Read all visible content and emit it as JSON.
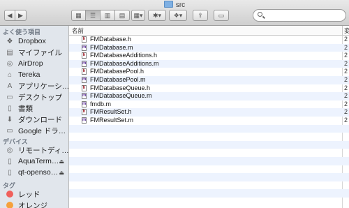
{
  "window": {
    "title": "src"
  },
  "toolbar": {
    "back_icon": "chevron-left-icon",
    "forward_icon": "chevron-right-icon",
    "view_buttons": [
      "icon-view-icon",
      "list-view-icon",
      "column-view-icon",
      "coverflow-view-icon",
      "arrange-icon"
    ],
    "action_icon": "gear-icon",
    "dropbox_icon": "dropbox-icon",
    "share_icon": "share-icon",
    "tag_icon": "tag-icon",
    "search_placeholder": ""
  },
  "sidebar": {
    "favorites_header": "よく使う項目",
    "favorites": [
      {
        "label": "Dropbox",
        "icon": "dropbox-icon"
      },
      {
        "label": "マイファイル",
        "icon": "all-files-icon"
      },
      {
        "label": "AirDrop",
        "icon": "airdrop-icon"
      },
      {
        "label": "Tereka",
        "icon": "home-icon"
      },
      {
        "label": "アプリケーシ…",
        "icon": "applications-icon"
      },
      {
        "label": "デスクトップ",
        "icon": "desktop-icon"
      },
      {
        "label": "書類",
        "icon": "documents-icon"
      },
      {
        "label": "ダウンロード",
        "icon": "downloads-icon"
      },
      {
        "label": "Google ドラ…",
        "icon": "folder-icon"
      }
    ],
    "devices_header": "デバイス",
    "devices": [
      {
        "label": "リモートディ…",
        "icon": "remote-disc-icon"
      },
      {
        "label": "AquaTerm…",
        "icon": "disk-icon",
        "eject": "⏏"
      },
      {
        "label": "qt-openso…",
        "icon": "disk-icon",
        "eject": "⏏"
      }
    ],
    "tags_header": "タグ",
    "tags": [
      {
        "label": "レッド",
        "color": "#f0605c"
      },
      {
        "label": "オレンジ",
        "color": "#f5a13c"
      }
    ]
  },
  "list": {
    "name_header": "名前",
    "date_header": "変",
    "files": [
      {
        "name": "FMDatabase.h",
        "type": "h",
        "date": "2"
      },
      {
        "name": "FMDatabase.m",
        "type": "m",
        "date": "2"
      },
      {
        "name": "FMDatabaseAdditions.h",
        "type": "h",
        "date": "2"
      },
      {
        "name": "FMDatabaseAdditions.m",
        "type": "m",
        "date": "2"
      },
      {
        "name": "FMDatabasePool.h",
        "type": "h",
        "date": "2"
      },
      {
        "name": "FMDatabasePool.m",
        "type": "m",
        "date": "2"
      },
      {
        "name": "FMDatabaseQueue.h",
        "type": "h",
        "date": "2"
      },
      {
        "name": "FMDatabaseQueue.m",
        "type": "m",
        "date": "2"
      },
      {
        "name": "fmdb.m",
        "type": "m",
        "date": "2"
      },
      {
        "name": "FMResultSet.h",
        "type": "h",
        "date": "2"
      },
      {
        "name": "FMResultSet.m",
        "type": "m",
        "date": "2"
      }
    ]
  }
}
